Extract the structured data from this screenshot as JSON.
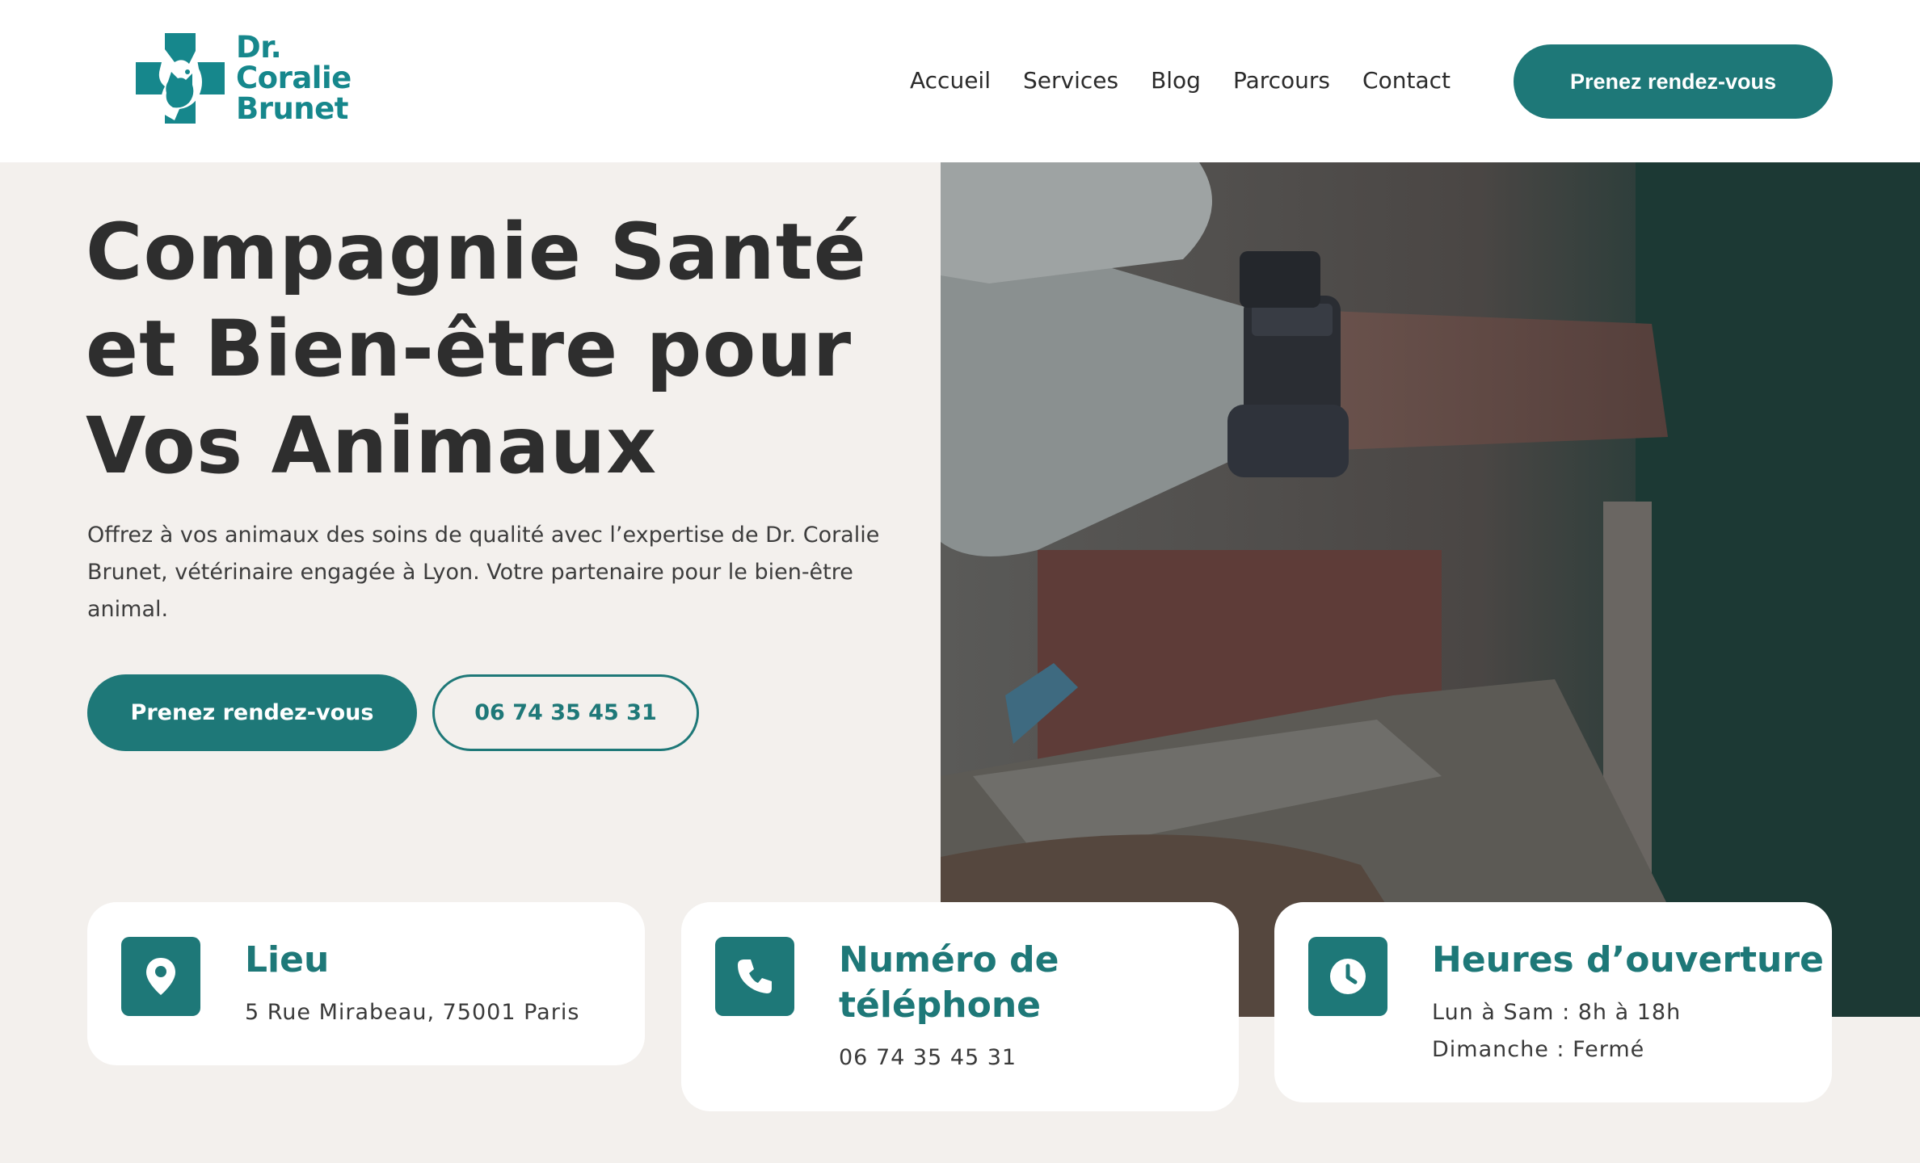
{
  "brand": {
    "line1": "Dr.",
    "line2": "Coralie",
    "line3": "Brunet",
    "color": "#16878c"
  },
  "nav": {
    "items": [
      "Accueil",
      "Services",
      "Blog",
      "Parcours",
      "Contact"
    ],
    "cta": "Prenez rendez-vous"
  },
  "hero": {
    "title": "Compagnie Santé et Bien-être pour Vos Animaux",
    "subtitle": "Offrez à vos animaux des soins de qualité avec l’expertise de Dr. Coralie Brunet, vétérinaire engagée à Lyon. Votre partenaire pour le bien-être animal.",
    "primary_button": "Prenez rendez-vous",
    "phone_button": "06 74 35 45 31",
    "image": "veterinarian-hands-with-dog-photo"
  },
  "cards": [
    {
      "icon": "location-pin-icon",
      "title": "Lieu",
      "lines": [
        "5 Rue Mirabeau, 75001 Paris"
      ]
    },
    {
      "icon": "phone-icon",
      "title": "Numéro de téléphone",
      "lines": [
        "06 74 35 45 31"
      ]
    },
    {
      "icon": "clock-icon",
      "title": "Heures d’ouverture",
      "lines": [
        "Lun à Sam : 8h à 18h",
        "Dimanche : Fermé"
      ]
    }
  ],
  "colors": {
    "accent": "#1e7878",
    "background": "#f3f0ed",
    "text": "#2e2e2e"
  }
}
